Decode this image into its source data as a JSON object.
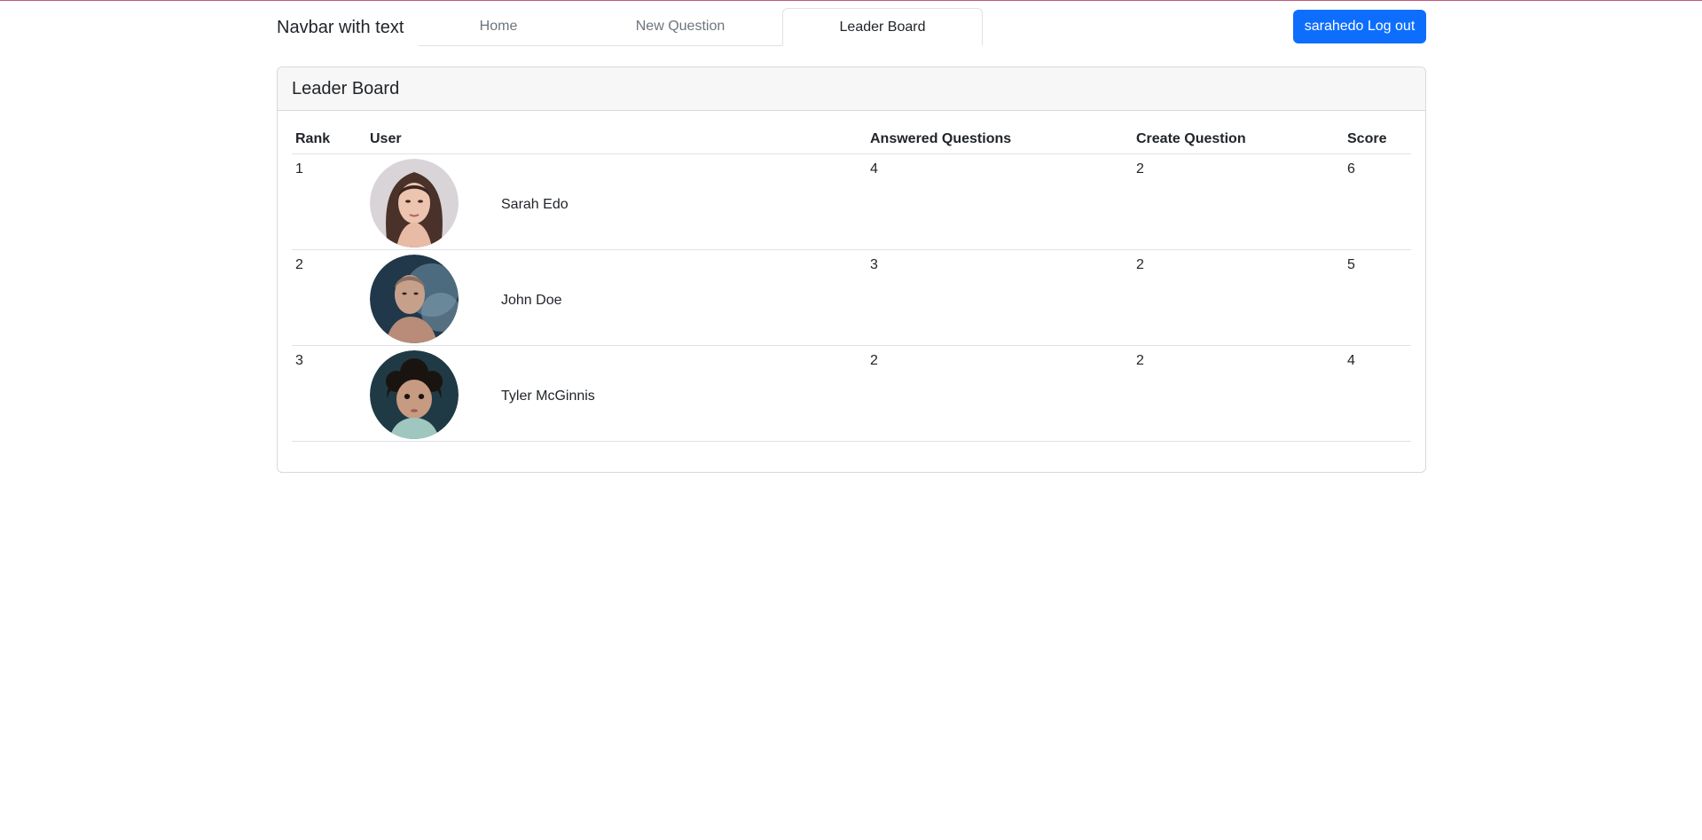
{
  "navbar": {
    "brand": "Navbar with text",
    "tabs": [
      {
        "label": "Home"
      },
      {
        "label": "New Question"
      },
      {
        "label": "Leader Board"
      }
    ],
    "logout_label": "sarahedo Log out"
  },
  "leaderboard": {
    "title": "Leader Board",
    "columns": [
      "Rank",
      "User",
      "Answered Questions",
      "Create Question",
      "Score"
    ],
    "rows": [
      {
        "rank": "1",
        "name": "Sarah Edo",
        "answered": "4",
        "created": "2",
        "score": "6"
      },
      {
        "rank": "2",
        "name": "John Doe",
        "answered": "3",
        "created": "2",
        "score": "5"
      },
      {
        "rank": "3",
        "name": "Tyler McGinnis",
        "answered": "2",
        "created": "2",
        "score": "4"
      }
    ]
  },
  "colors": {
    "primary": "#0d6efd",
    "top_border": "#c0587a"
  }
}
